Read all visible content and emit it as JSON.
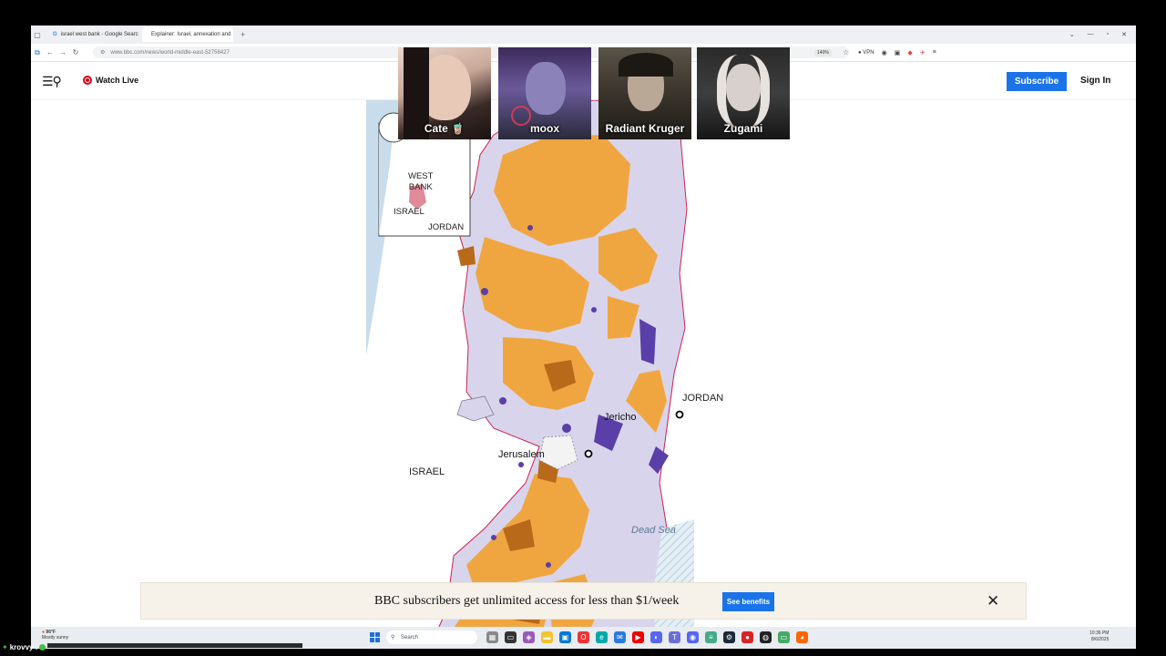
{
  "browser": {
    "tabs": [
      {
        "title": "israel west bank - Google Searc",
        "icon": "google-icon"
      },
      {
        "title": "Explainer: Israel, annexation and",
        "icon": "bbc-icon"
      }
    ],
    "new_tab": "+",
    "url": "www.bbc.com/news/world-middle-east-52756427",
    "zoom": "140%",
    "vpn_label": "VPN"
  },
  "header": {
    "watch_live": "Watch Live",
    "subscribe": "Subscribe",
    "sign_in": "Sign In"
  },
  "map": {
    "inset": {
      "west_bank": "WEST\nBANK",
      "israel": "ISRAEL",
      "jordan": "JORDAN"
    },
    "labels": {
      "jordan": "JORDAN",
      "israel": "ISRAEL",
      "jericho": "Jericho",
      "jerusalem": "Jerusalem",
      "dead_sea": "Dead Sea"
    },
    "colors": {
      "palestinian_area": "#f0a640",
      "israeli_area": "#d8d4ec",
      "settlement": "#5a3fa8",
      "border": "#d0214f",
      "sea": "#c8dcec"
    }
  },
  "webcams": [
    {
      "name": "Cate 🧋"
    },
    {
      "name": "moox"
    },
    {
      "name": "Radiant Kruger"
    },
    {
      "name": "Zugami"
    }
  ],
  "banner": {
    "text": "BBC subscribers get unlimited access for less than $1/week",
    "button": "See benefits",
    "close": "✕"
  },
  "taskbar": {
    "temperature": "96°F",
    "weather_text": "Mostly sunny",
    "search_placeholder": "Search",
    "time": "10:36 PM",
    "date": "8/6/2025"
  },
  "stream": {
    "user": "krovvy :"
  }
}
